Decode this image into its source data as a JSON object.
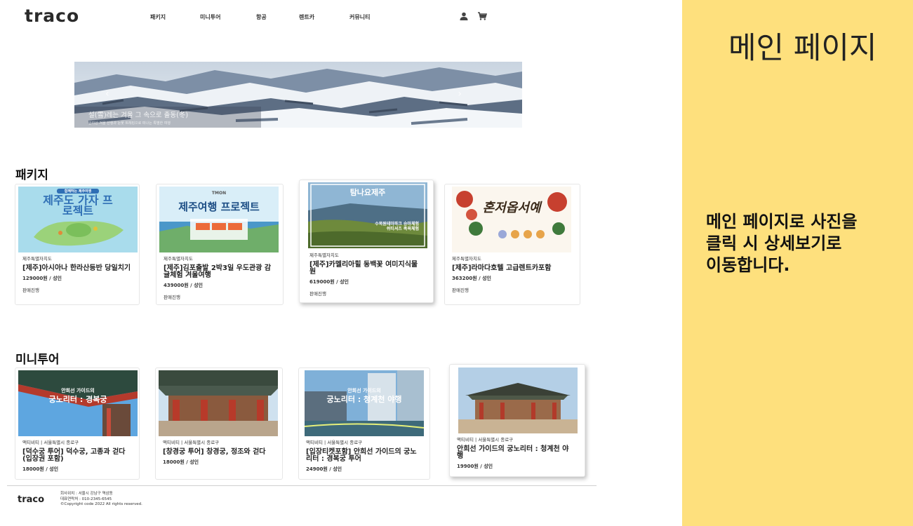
{
  "header": {
    "logo": "traco",
    "nav": [
      {
        "label": "패키지"
      },
      {
        "label": "미니투어"
      },
      {
        "label": "항공"
      },
      {
        "label": "렌트카"
      },
      {
        "label": "커뮤니티"
      }
    ],
    "icons": [
      "user-icon",
      "cart-icon"
    ]
  },
  "banner": {
    "title": "설(雪)레는 겨울 그 속으로 출동(冬)",
    "subtitle": "한라산 겨울 산행과 눈꽃 트레킹으로 떠나는 특별한 여행"
  },
  "packages": {
    "section_title": "패키지",
    "items": [
      {
        "region": "제주특별자치도",
        "title": "[제주]아시아나 한라산등반 당일치기",
        "price": "129000원 / 성인",
        "status": "판매진행",
        "image_text": "제주도 가자 프로젝트",
        "image_badge": "함께하는 제주여행"
      },
      {
        "region": "제주특별자치도",
        "title": "[제주]김포출발 2박3일 우도관광 감귤체험 겨울여행",
        "price": "439000원 / 성인",
        "status": "판매진행",
        "image_text": "제주여행 프로젝트",
        "image_badge": "TMON"
      },
      {
        "region": "제주특별자치도",
        "title": "[제주]카멜리아힐 동백꽃 여미지식물원",
        "price": "619000원 / 성인",
        "status": "판매진행",
        "image_text": "탐나요제주",
        "image_badge": "수목원테마파크 승마체험 쉬티셔츠 족욕체험"
      },
      {
        "region": "제주특별자치도",
        "title": "[제주]라마다호텔 고급렌트카포함",
        "price": "363200원 / 성인",
        "status": "판매진행",
        "image_text": "혼저옵서예",
        "image_badge": ""
      }
    ]
  },
  "minitours": {
    "section_title": "미니투어",
    "items": [
      {
        "region": "액티비티 | 서울특별시 종로구",
        "title": "[덕수궁 투어] 덕수궁, 고종과 걷다 (입장권 포함)",
        "price": "18000원 / 성인",
        "image_text": "궁노리터 : 경복궁",
        "image_badge": "안희선 가이드의"
      },
      {
        "region": "액티비티 | 서울특별시 종로구",
        "title": "[창경궁 투어] 창경궁, 정조와 걷다",
        "price": "18000원 / 성인",
        "image_text": "",
        "image_badge": ""
      },
      {
        "region": "액티비티 | 서울특별시 종로구",
        "title": "[입장티켓포함] 안희선 가이드의 궁노리터 : 경복궁 투어",
        "price": "24900원 / 성인",
        "image_text": "궁노리터 : 청계천 야행",
        "image_badge": "안희선 가이드의"
      },
      {
        "region": "액티비티 | 서울특별시 종로구",
        "title": "안희선 가이드의 궁노리터 : 청계천 야행",
        "price": "19900원 / 성인",
        "image_text": "",
        "image_badge": ""
      }
    ]
  },
  "footer": {
    "logo": "traco",
    "address": "회사위치 : 서울시 강남구 역삼동",
    "phone": "대표연락처 : 010-2345-6545",
    "copyright": "©Copyright code 2022 All rights reserved."
  },
  "annotation": {
    "title": "메인 페이지",
    "lines": [
      "메인 페이지로 사진을",
      "클릭 시 상세보기로",
      "이동합니다."
    ]
  },
  "colors": {
    "panel_bg": "#fee07d",
    "text": "#222222"
  }
}
